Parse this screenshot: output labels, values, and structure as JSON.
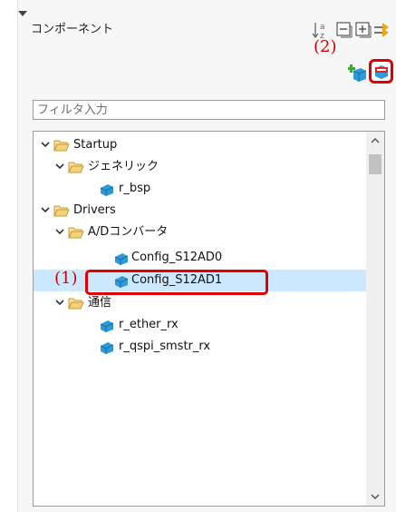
{
  "header": {
    "title": "コンポーネント"
  },
  "annotations": {
    "label_2": "(2)",
    "label_1": "(1)"
  },
  "filter": {
    "placeholder": "フィルタ入力"
  },
  "tree": {
    "startup": "Startup",
    "generic": "ジェネリック",
    "r_bsp": "r_bsp",
    "drivers": "Drivers",
    "ad_converter": "A/Dコンバータ",
    "config_s12ad0": "Config_S12AD0",
    "config_s12ad1": "Config_S12AD1",
    "comm": "通信",
    "r_ether_rx": "r_ether_rx",
    "r_qspi_smstr_rx": "r_qspi_smstr_rx"
  },
  "colors": {
    "accent": "#e00000",
    "selection": "#cce8ff",
    "folder": "#e8b84a",
    "component": "#2e9ad8"
  }
}
